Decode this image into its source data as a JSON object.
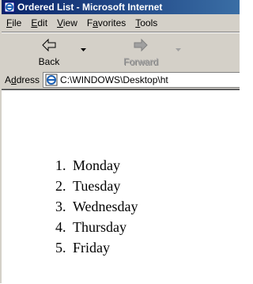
{
  "window": {
    "title": "Ordered List - Microsoft Internet",
    "colors": {
      "titlebar_start": "#0a246a",
      "titlebar_end": "#3a6ea5",
      "chrome": "#d4d0c8"
    }
  },
  "menubar": {
    "items": [
      {
        "label_u": "F",
        "label_rest": "ile"
      },
      {
        "label_u": "E",
        "label_rest": "dit"
      },
      {
        "label_u": "V",
        "label_rest": "iew"
      },
      {
        "label_pre": "F",
        "label_u": "a",
        "label_rest": "vorites"
      },
      {
        "label_u": "T",
        "label_rest": "ools"
      }
    ]
  },
  "toolbar": {
    "back_label": "Back",
    "forward_label": "Forward",
    "back_icon": "back-arrow-icon",
    "forward_icon": "forward-arrow-icon"
  },
  "addressbar": {
    "label_pre": "A",
    "label_u": "d",
    "label_rest": "dress",
    "value": "C:\\WINDOWS\\Desktop\\ht",
    "icon": "ie-page-icon"
  },
  "content": {
    "list": [
      "Monday",
      "Tuesday",
      "Wednesday",
      "Thursday",
      "Friday"
    ]
  }
}
